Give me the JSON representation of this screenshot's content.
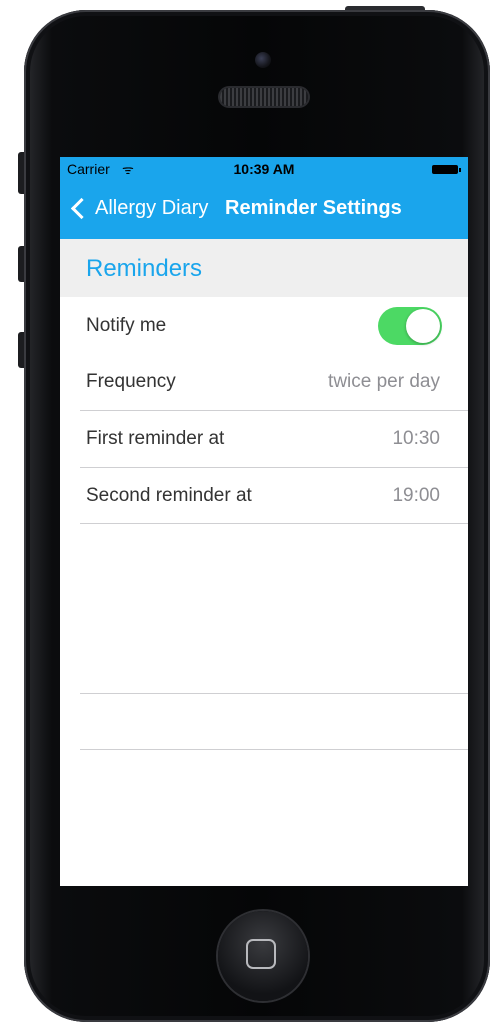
{
  "status_bar": {
    "carrier": "Carrier",
    "wifi_icon": "wifi-icon",
    "time": "10:39 AM",
    "battery_icon": "battery-icon"
  },
  "nav": {
    "back_label": "Allergy Diary",
    "title": "Reminder Settings",
    "bar_color": "#1aa5ec"
  },
  "section": {
    "title": "Reminders"
  },
  "rows": [
    {
      "label": "Notify me",
      "toggle_on": true,
      "toggle_color": "#4cd964"
    },
    {
      "label": "Frequency",
      "value": "twice per day"
    },
    {
      "label": "First reminder at",
      "value": "10:30"
    },
    {
      "label": "Second reminder at",
      "value": "19:00"
    }
  ]
}
